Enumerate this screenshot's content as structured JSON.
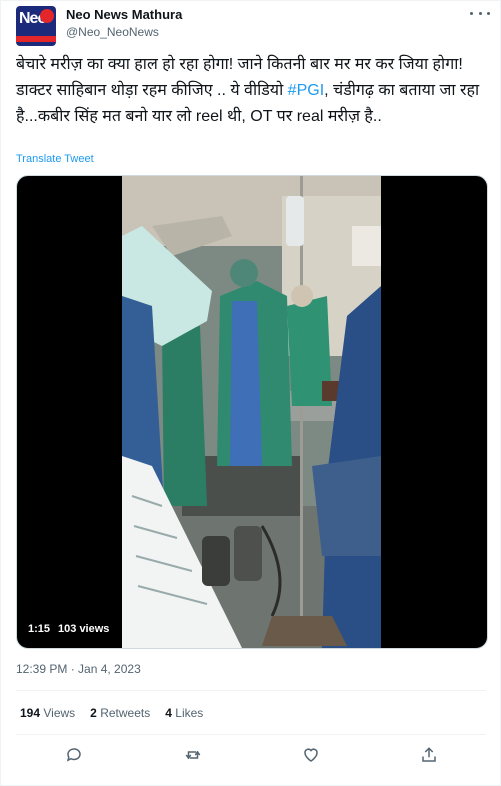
{
  "account": {
    "name": "Neo News Mathura",
    "handle": "@Neo_NeoNews"
  },
  "tweet": {
    "text_part1": "बेचारे मरीज़ का क्या हाल हो रहा होगा! जाने कितनी बार मर मर कर जिया होगा! डाक्टर साहिबान थोड़ा रहम कीजिए .. ये वीडियो ",
    "hashtag": "#PGI",
    "text_part2": ", चंडीगढ़ का बताया जा रहा है...कबीर सिंह मत बनो यार लो reel थी, OT पर real मरीज़ है..",
    "translate": "Translate Tweet"
  },
  "video": {
    "duration": "1:15",
    "views": "103 views"
  },
  "timestamp": "12:39 PM · Jan 4, 2023",
  "stats": {
    "views_count": "194",
    "views_label": "Views",
    "retweets_count": "2",
    "retweets_label": "Retweets",
    "likes_count": "4",
    "likes_label": "Likes"
  },
  "colors": {
    "accent": "#1d9bf0",
    "secondary_text": "#536471"
  }
}
